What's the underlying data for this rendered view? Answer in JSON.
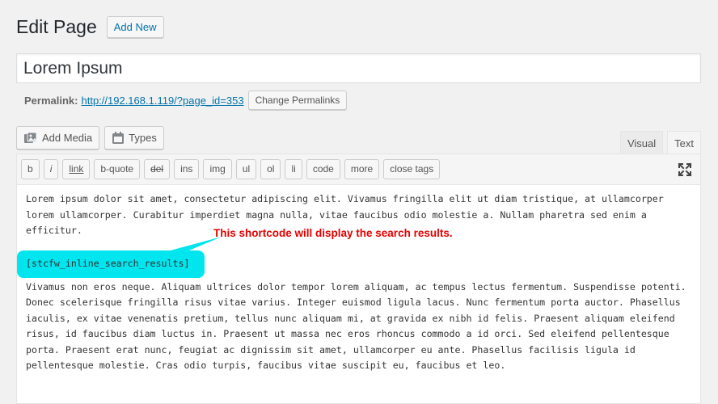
{
  "header": {
    "title": "Edit Page",
    "add_new_label": "Add New"
  },
  "post": {
    "title": "Lorem Ipsum"
  },
  "permalink": {
    "label": "Permalink:",
    "url": "http://192.168.1.119/?page_id=353",
    "change_label": "Change Permalinks"
  },
  "media_buttons": {
    "add_media_label": "Add Media",
    "add_media_icon": "add-media-icon",
    "types_label": "Types",
    "types_icon": "types-icon"
  },
  "editor_tabs": {
    "visual_label": "Visual",
    "text_label": "Text",
    "active": "Text"
  },
  "quicktags": {
    "buttons": [
      "b",
      "i",
      "link",
      "b-quote",
      "del",
      "ins",
      "img",
      "ul",
      "ol",
      "li",
      "code",
      "more",
      "close tags"
    ],
    "fullscreen_icon": "fullscreen-icon"
  },
  "content": {
    "paragraph1": "Lorem ipsum dolor sit amet, consectetur adipiscing elit. Vivamus fringilla elit ut diam tristique, at ullamcorper lorem ullamcorper. Curabitur imperdiet magna nulla, vitae faucibus odio molestie a. Nullam pharetra sed enim a efficitur.",
    "shortcode": "[stcfw_inline_search_results]",
    "annotation": "This shortcode will display the search results.",
    "paragraph2": "Vivamus non eros neque. Aliquam ultrices dolor tempor lorem aliquam, ac tempus lectus fermentum. Suspendisse potenti. Donec scelerisque fringilla risus vitae varius. Integer euismod ligula lacus. Nunc fermentum porta auctor. Phasellus iaculis, ex vitae venenatis pretium, tellus nunc aliquam mi, at gravida ex nibh id felis. Praesent aliquam eleifend risus, id faucibus diam luctus in. Praesent ut massa nec eros rhoncus commodo a id orci. Sed eleifend pellentesque porta. Praesent erat nunc, feugiat ac dignissim sit amet, ullamcorper eu ante. Phasellus facilisis ligula id pellentesque molestie. Cras odio turpis, faucibus vitae suscipit eu, faucibus et leo."
  },
  "colors": {
    "accent": "#0073aa",
    "highlight": "#00e5ee",
    "annotation": "#e60000"
  }
}
